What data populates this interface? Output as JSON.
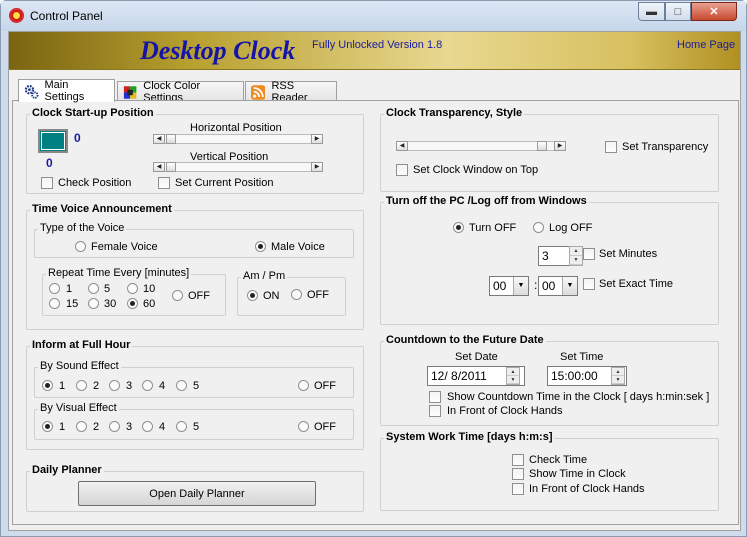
{
  "window": {
    "title": "Control Panel"
  },
  "banner": {
    "title": "Desktop Clock",
    "version": "Fully Unlocked Version 1.8",
    "home_link": "Home Page"
  },
  "tabs": [
    {
      "label": "Main Settings",
      "icon": "gears-icon"
    },
    {
      "label": "Clock Color Settings",
      "icon": "palette-icon"
    },
    {
      "label": "RSS Reader",
      "icon": "rss-icon"
    }
  ],
  "startup": {
    "title": "Clock Start-up Position",
    "x_value": "0",
    "y_value": "0",
    "horizontal_label": "Horizontal Position",
    "vertical_label": "Vertical Position",
    "check_position": "Check Position",
    "set_current_position": "Set Current Position",
    "swatch_color": "#008080"
  },
  "voice": {
    "title": "Time Voice Announcement",
    "type_label": "Type of the Voice",
    "female": "Female Voice",
    "male": "Male Voice",
    "repeat_label": "Repeat Time Every  [minutes]",
    "repeat_options": [
      "1",
      "5",
      "10",
      "15",
      "30",
      "60",
      "OFF"
    ],
    "repeat_selected": "60",
    "ampm_label": "Am / Pm",
    "ampm_on": "ON",
    "ampm_off": "OFF"
  },
  "inform": {
    "title": "Inform at Full Hour",
    "sound_label": "By Sound Effect",
    "visual_label": "By Visual Effect",
    "options": [
      "1",
      "2",
      "3",
      "4",
      "5"
    ],
    "off": "OFF"
  },
  "planner": {
    "title": "Daily Planner",
    "button": "Open Daily Planner"
  },
  "transparency": {
    "title": "Clock Transparency, Style",
    "set_transparency": "Set Transparency",
    "on_top": "Set Clock Window on Top"
  },
  "shutdown": {
    "title": "Turn off the PC /Log off from Windows",
    "turn_off": "Turn OFF",
    "log_off": "Log OFF",
    "minutes_value": "3",
    "set_minutes": "Set Minutes",
    "hour_value": "00",
    "minute_value": "00",
    "colon": ":",
    "set_exact_time": "Set Exact Time"
  },
  "countdown": {
    "title": "Countdown to the Future Date",
    "set_date_label": "Set Date",
    "set_time_label": "Set Time",
    "date_value": "12/  8/2011",
    "time_value": "15:00:00",
    "show_countdown": "Show Countdown Time in the Clock  [ days  h:min:sek ]",
    "in_front": "In Front of Clock Hands"
  },
  "worktime": {
    "title": "System Work Time [days h:m:s]",
    "check_time": "Check Time",
    "show_time": "Show Time in Clock",
    "in_front": "In Front of Clock Hands"
  }
}
